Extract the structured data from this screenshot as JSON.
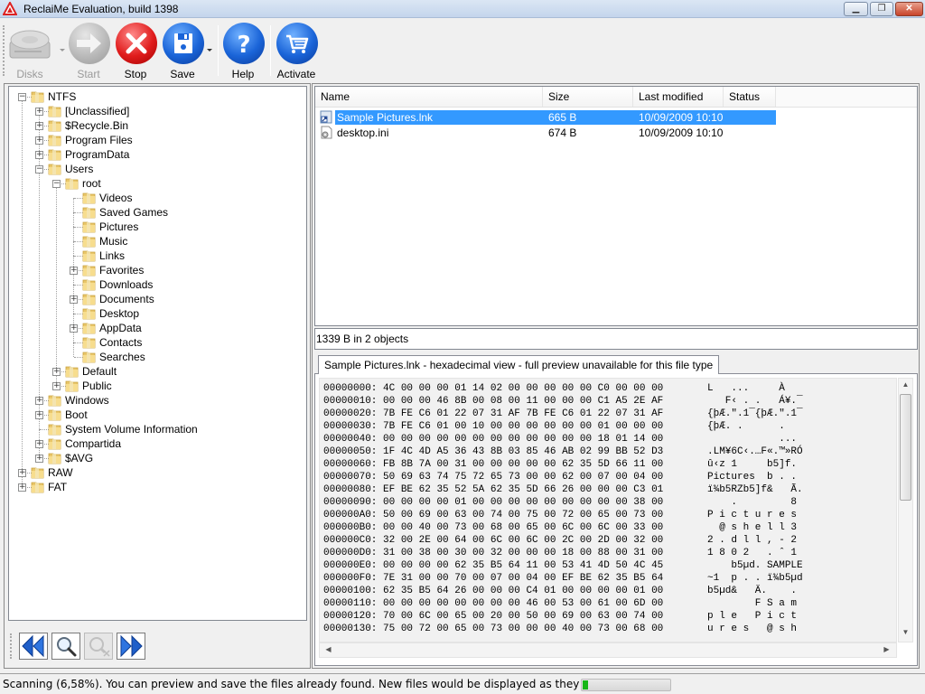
{
  "window": {
    "title": "ReclaiMe Evaluation, build 1398",
    "app_icon": "warning-triangle-icon",
    "controls": {
      "minimize": "minimize-icon",
      "maximize": "restore-icon",
      "close": "close-icon"
    }
  },
  "toolbar": {
    "buttons": [
      {
        "id": "disks",
        "label": "Disks",
        "icon": "hard-disk-icon",
        "enabled": false,
        "dropdown": true
      },
      {
        "id": "start",
        "label": "Start",
        "icon": "arrow-right-icon",
        "enabled": false,
        "dropdown": false
      },
      {
        "id": "stop",
        "label": "Stop",
        "icon": "stop-x-icon",
        "enabled": true,
        "dropdown": false
      },
      {
        "id": "save",
        "label": "Save",
        "icon": "floppy-disk-icon",
        "enabled": true,
        "dropdown": true
      },
      {
        "id": "help",
        "label": "Help",
        "icon": "question-icon",
        "enabled": true,
        "dropdown": false
      },
      {
        "id": "activate",
        "label": "Activate",
        "icon": "shopping-cart-icon",
        "enabled": true,
        "dropdown": false
      }
    ]
  },
  "tree": {
    "nodes": [
      {
        "label": "NTFS",
        "level": 0,
        "expander": "minus"
      },
      {
        "label": "[Unclassified]",
        "level": 1,
        "expander": "plus"
      },
      {
        "label": "$Recycle.Bin",
        "level": 1,
        "expander": "plus"
      },
      {
        "label": "Program Files",
        "level": 1,
        "expander": "plus"
      },
      {
        "label": "ProgramData",
        "level": 1,
        "expander": "plus"
      },
      {
        "label": "Users",
        "level": 1,
        "expander": "minus"
      },
      {
        "label": "root",
        "level": 2,
        "expander": "minus"
      },
      {
        "label": "Videos",
        "level": 3,
        "expander": "none"
      },
      {
        "label": "Saved Games",
        "level": 3,
        "expander": "none"
      },
      {
        "label": "Pictures",
        "level": 3,
        "expander": "none"
      },
      {
        "label": "Music",
        "level": 3,
        "expander": "none"
      },
      {
        "label": "Links",
        "level": 3,
        "expander": "none"
      },
      {
        "label": "Favorites",
        "level": 3,
        "expander": "plus"
      },
      {
        "label": "Downloads",
        "level": 3,
        "expander": "none"
      },
      {
        "label": "Documents",
        "level": 3,
        "expander": "plus"
      },
      {
        "label": "Desktop",
        "level": 3,
        "expander": "none"
      },
      {
        "label": "AppData",
        "level": 3,
        "expander": "plus"
      },
      {
        "label": "Contacts",
        "level": 3,
        "expander": "none"
      },
      {
        "label": "Searches",
        "level": 3,
        "expander": "none"
      },
      {
        "label": "Default",
        "level": 2,
        "expander": "plus"
      },
      {
        "label": "Public",
        "level": 2,
        "expander": "plus"
      },
      {
        "label": "Windows",
        "level": 1,
        "expander": "plus"
      },
      {
        "label": "Boot",
        "level": 1,
        "expander": "plus"
      },
      {
        "label": "System Volume Information",
        "level": 1,
        "expander": "none"
      },
      {
        "label": "Compartida",
        "level": 1,
        "expander": "plus"
      },
      {
        "label": "$AVG",
        "level": 1,
        "expander": "plus"
      },
      {
        "label": "RAW",
        "level": 0,
        "expander": "plus"
      },
      {
        "label": "FAT",
        "level": 0,
        "expander": "plus"
      }
    ]
  },
  "tree_nav": {
    "buttons": [
      {
        "id": "prev",
        "icon": "double-chevron-left-icon",
        "enabled": true
      },
      {
        "id": "search",
        "icon": "magnifier-icon",
        "enabled": true
      },
      {
        "id": "clear-search",
        "icon": "magnifier-clear-icon",
        "enabled": false
      },
      {
        "id": "next",
        "icon": "double-chevron-right-icon",
        "enabled": true
      }
    ]
  },
  "file_list": {
    "columns": [
      "Name",
      "Size",
      "Last modified",
      "Status"
    ],
    "rows": [
      {
        "name": "Sample Pictures.lnk",
        "size": "665 B",
        "modified": "10/09/2009 10:10",
        "status": "",
        "icon": "shortcut-file-icon",
        "selected": true
      },
      {
        "name": "desktop.ini",
        "size": "674 B",
        "modified": "10/09/2009 10:10",
        "status": "",
        "icon": "settings-file-icon",
        "selected": false
      }
    ],
    "summary": "1339 B in 2 objects"
  },
  "preview": {
    "tab_label": "Sample Pictures.lnk - hexadecimal view - full preview unavailable for this file type",
    "hex_rows": [
      {
        "offset": "00000000:",
        "bytes": "4C 00 00 00 01 14 02 00 00 00 00 00 C0 00 00 00",
        "ascii": "L   ...     À   "
      },
      {
        "offset": "00000010:",
        "bytes": "00 00 00 46 8B 00 08 00 11 00 00 00 C1 A5 2E AF",
        "ascii": "   F‹ . .   Á¥.¯"
      },
      {
        "offset": "00000020:",
        "bytes": "7B FE C6 01 22 07 31 AF 7B FE C6 01 22 07 31 AF",
        "ascii": "{þÆ.\".1¯{þÆ.\".1¯"
      },
      {
        "offset": "00000030:",
        "bytes": "7B FE C6 01 00 10 00 00 00 00 00 00 01 00 00 00",
        "ascii": "{þÆ. .      .   "
      },
      {
        "offset": "00000040:",
        "bytes": "00 00 00 00 00 00 00 00 00 00 00 00 18 01 14 00",
        "ascii": "            ... "
      },
      {
        "offset": "00000050:",
        "bytes": "1F 4C 4D A5 36 43 8B 03 85 46 AB 02 99 BB 52 D3",
        "ascii": ".LM¥6C‹.…F«.™»RÓ"
      },
      {
        "offset": "00000060:",
        "bytes": "FB 8B 7A 00 31 00 00 00 00 00 62 35 5D 66 11 00",
        "ascii": "û‹z 1     b5]f. "
      },
      {
        "offset": "00000070:",
        "bytes": "50 69 63 74 75 72 65 73 00 00 62 00 07 00 04 00",
        "ascii": "Pictures  b . . "
      },
      {
        "offset": "00000080:",
        "bytes": "EF BE 62 35 52 5A 62 35 5D 66 26 00 00 00 C3 01",
        "ascii": "ï¾b5RZb5]f&   Ã."
      },
      {
        "offset": "00000090:",
        "bytes": "00 00 00 00 01 00 00 00 00 00 00 00 00 00 38 00",
        "ascii": "    .         8 "
      },
      {
        "offset": "000000A0:",
        "bytes": "50 00 69 00 63 00 74 00 75 00 72 00 65 00 73 00",
        "ascii": "P i c t u r e s "
      },
      {
        "offset": "000000B0:",
        "bytes": "00 00 40 00 73 00 68 00 65 00 6C 00 6C 00 33 00",
        "ascii": "  @ s h e l l 3 "
      },
      {
        "offset": "000000C0:",
        "bytes": "32 00 2E 00 64 00 6C 00 6C 00 2C 00 2D 00 32 00",
        "ascii": "2 . d l l , - 2 "
      },
      {
        "offset": "000000D0:",
        "bytes": "31 00 38 00 30 00 32 00 00 00 18 00 88 00 31 00",
        "ascii": "1 8 0 2   . ˆ 1 "
      },
      {
        "offset": "000000E0:",
        "bytes": "00 00 00 00 62 35 B5 64 11 00 53 41 4D 50 4C 45",
        "ascii": "    b5µd. SAMPLE"
      },
      {
        "offset": "000000F0:",
        "bytes": "7E 31 00 00 70 00 07 00 04 00 EF BE 62 35 B5 64",
        "ascii": "~1  p . . ï¾b5µd"
      },
      {
        "offset": "00000100:",
        "bytes": "62 35 B5 64 26 00 00 00 C4 01 00 00 00 00 01 00",
        "ascii": "b5µd&   Ä.    . "
      },
      {
        "offset": "00000110:",
        "bytes": "00 00 00 00 00 00 00 00 46 00 53 00 61 00 6D 00",
        "ascii": "        F S a m "
      },
      {
        "offset": "00000120:",
        "bytes": "70 00 6C 00 65 00 20 00 50 00 69 00 63 00 74 00",
        "ascii": "p l e   P i c t "
      },
      {
        "offset": "00000130:",
        "bytes": "75 00 72 00 65 00 73 00 00 00 40 00 73 00 68 00",
        "ascii": "u r e s   @ s h "
      }
    ]
  },
  "status": {
    "text": "Scanning (6,58%). You can preview and save the files already found. New files would be displayed as they are discovered.",
    "progress_percent": 6.58,
    "progress_color": "#16b616"
  },
  "colors": {
    "selection": "#3399ff",
    "stop_red": "#e01c1c",
    "action_blue": "#1a64d8"
  }
}
